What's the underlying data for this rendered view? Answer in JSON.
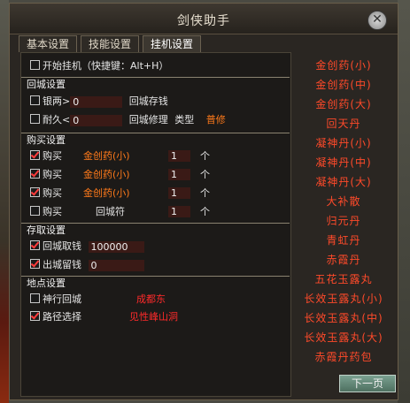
{
  "window": {
    "title": "剑侠助手",
    "close_icon": "close-icon"
  },
  "tabs": [
    {
      "label": "基本设置"
    },
    {
      "label": "技能设置"
    },
    {
      "label": "挂机设置"
    }
  ],
  "active_tab": "挂机设置",
  "start": {
    "label": "开始挂机（快捷键：Alt+H）",
    "checked": false
  },
  "sections": {
    "return": "回城设置",
    "buy": "购买设置",
    "storage": "存取设置",
    "location": "地点设置"
  },
  "return": {
    "silver": {
      "label": "银两>",
      "value": "0",
      "action": "回城存钱",
      "checked": false
    },
    "durability": {
      "label": "耐久<",
      "value": "0",
      "action": "回城修理",
      "type_label": "类型",
      "type_value": "普修",
      "checked": false
    }
  },
  "buy": [
    {
      "label": "购买",
      "item": "金创药(小)",
      "qty": "1",
      "unit": "个",
      "checked": true
    },
    {
      "label": "购买",
      "item": "金创药(小)",
      "qty": "1",
      "unit": "个",
      "checked": true
    },
    {
      "label": "购买",
      "item": "金创药(小)",
      "qty": "1",
      "unit": "个",
      "checked": true
    },
    {
      "label": "购买",
      "item": "回城符",
      "qty": "1",
      "unit": "个",
      "checked": false
    }
  ],
  "storage": {
    "withdraw": {
      "label": "回城取钱",
      "value": "100000",
      "checked": true
    },
    "keep": {
      "label": "出城留钱",
      "value": "0",
      "checked": true
    }
  },
  "location": {
    "walk": {
      "label": "神行回城",
      "value": "成都东",
      "checked": false
    },
    "path": {
      "label": "路径选择",
      "value": "见性峰山洞",
      "checked": true
    }
  },
  "item_list": [
    "金创药(小)",
    "金创药(中)",
    "金创药(大)",
    "回天丹",
    "凝神丹(小)",
    "凝神丹(中)",
    "凝神丹(大)",
    "大补散",
    "归元丹",
    "青虹丹",
    "赤霞丹",
    "五花玉露丸",
    "长效玉露丸(小)",
    "长效玉露丸(中)",
    "长效玉露丸(大)",
    "赤霞丹药包"
  ],
  "next_button": "下一页"
}
